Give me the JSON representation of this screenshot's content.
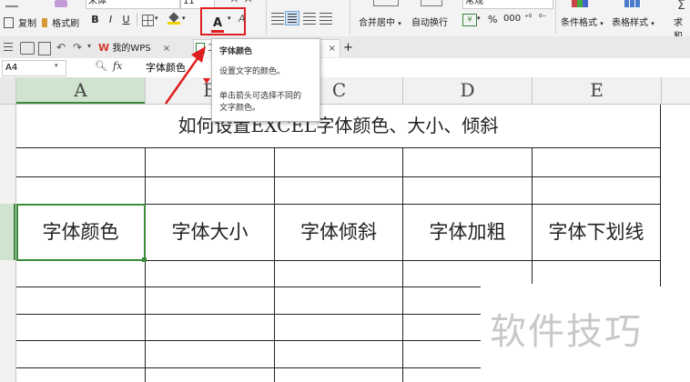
{
  "ribbon": {
    "clipboard": {
      "copy": "复制",
      "format_painter": "格式刷"
    },
    "font_name": "宋体",
    "font_size": "11",
    "bold": "B",
    "italic": "I",
    "underline": "U",
    "font_color_glyph": "A",
    "merge_center": "合并居中",
    "wrap_text": "自动换行",
    "number_format": "常规",
    "percent": "%",
    "thousands": "000",
    "cond_format": "条件格式",
    "table_style": "表格样式",
    "sum": "求和"
  },
  "tabs": {
    "my_wps": "我的WPS",
    "doc_prefix": "工",
    "add": "+"
  },
  "formula_bar": {
    "cell_ref": "A4",
    "fx": "fx",
    "content": "字体颜色"
  },
  "tooltip": {
    "title": "字体颜色",
    "line1": "设置文字的颜色。",
    "line2": "单击箭头可选择不同的",
    "line3": "文字颜色。"
  },
  "columns": [
    "A",
    "B",
    "C",
    "D",
    "E"
  ],
  "sheet": {
    "title": "如何设置EXCEL字体颜色、大小、倾斜",
    "headers": [
      "字体颜色",
      "字体大小",
      "字体倾斜",
      "字体加粗",
      "字体下划线"
    ]
  },
  "watermark": "软件技巧",
  "colors": {
    "selection": "#3c8c3c",
    "highlight_red": "#e02020",
    "font_color_red": "#e02020"
  }
}
